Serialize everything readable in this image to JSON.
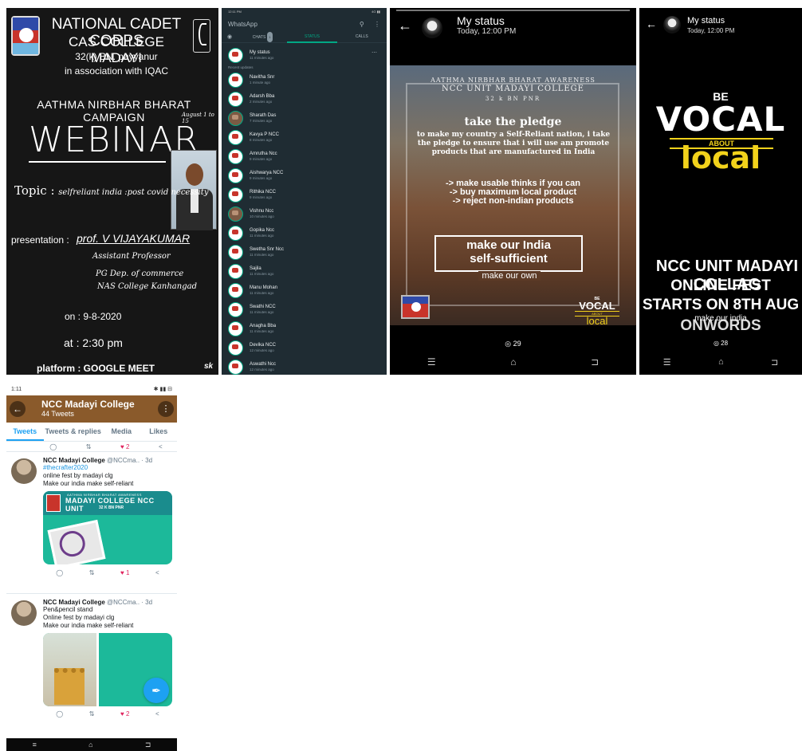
{
  "poster": {
    "line1": "NATIONAL CADET CORPS",
    "line2": "CAS COLLEGE MADAYI",
    "line3": "32(k) BN. payyanur",
    "line4": "in association with IQAC",
    "campaign": "AATHMA NIRBHAR BHARAT CAMPAIGN",
    "dates": "August 1 to 15",
    "webinar": "WEBINAR",
    "topic_label": "Topic :",
    "topic_value": "selfreliant india :post covid necessity",
    "presentation_label": "presentation :",
    "presenter": "prof. V VIJAYAKUMAR",
    "presenter_lines": [
      "Assistant Professor",
      "PG Dep. of commerce",
      "NAS College Kanhangad"
    ],
    "on": "on  : 9-8-2020",
    "at": "at  : 2:30 pm",
    "platform": "platform  : GOOGLE MEET",
    "signature": "sk"
  },
  "whatsapp": {
    "status_time": "12:11 PM",
    "status_icons": "4G ▮▮",
    "app_title": "WhatsApp",
    "tabs": [
      "CHATS",
      "STATUS",
      "CALLS"
    ],
    "chats_badge": "1",
    "my_status": {
      "name": "My status",
      "time": "11 minutes ago"
    },
    "recent_label": "Recent updates",
    "updates": [
      {
        "name": "Navitha Snr",
        "time": "1 minute ago"
      },
      {
        "name": "Adarsh Bba",
        "time": "2 minutes ago"
      },
      {
        "name": "Sharath Das",
        "time": "7 minutes ago"
      },
      {
        "name": "Kavya P NCC",
        "time": "8 minutes ago"
      },
      {
        "name": "Amrutha Ncc",
        "time": "9 minutes ago"
      },
      {
        "name": "Aishwarya NCC",
        "time": "9 minutes ago"
      },
      {
        "name": "Rithika NCC",
        "time": "9 minutes ago"
      },
      {
        "name": "Vishnu Ncc",
        "time": "10 minutes ago"
      },
      {
        "name": "Gopika Ncc",
        "time": "11 minutes ago"
      },
      {
        "name": "Swetha Snr Ncc",
        "time": "11 minutes ago"
      },
      {
        "name": "Sajila",
        "time": "11 minutes ago"
      },
      {
        "name": "Manu Mohan",
        "time": "11 minutes ago"
      },
      {
        "name": "Swathi NCC",
        "time": "11 minutes ago"
      },
      {
        "name": "Anagha Bba",
        "time": "11 minutes ago"
      },
      {
        "name": "Devika NCC",
        "time": "12 minutes ago"
      },
      {
        "name": "Aswathi Ncc",
        "time": "12 minutes ago"
      }
    ]
  },
  "pledge_status": {
    "title": "My status",
    "time": "Today, 12:00 PM",
    "aw1": "AATHMA NIRBHAR BHARAT AWARENESS",
    "aw2": "NCC UNIT MADAYI COLLEGE",
    "aw3": "32  k  BN  PNR",
    "heading": "take the pledge",
    "text": "to make my country a Self-Reliant nation, i take the pledge to ensure that i will use am promote products that are manufactured in India",
    "bullets": [
      "-> make usable thinks if you can",
      "-> buy maximum local product",
      "-> reject non-indian products"
    ],
    "box1": "make our India",
    "box2": "self-sufficient",
    "box3": "make our own",
    "vocal_be": "BE",
    "vocal_v": "VOCAL",
    "vocal_about": "ABOUT",
    "vocal_local": "local",
    "views": "29",
    "nav": [
      "☰",
      "⌂",
      "⊐"
    ]
  },
  "vocal_status": {
    "title": "My status",
    "time": "Today, 12:00 PM",
    "be": "BE",
    "vocal": "VOCAL",
    "about": "ABOUT",
    "local": "local",
    "fest1": "NCC UNIT MADAYI COLLAG",
    "fest2": "ONLINE FEST",
    "fest3": "STARTS ON 8TH AUG",
    "fest4": "ONWORDS",
    "ourindia": "make our india",
    "views": "28",
    "nav": [
      "☰",
      "⌂",
      "⊐"
    ]
  },
  "twitter": {
    "status_left": "1:11",
    "status_right": "✱ ▮▮ ⊟",
    "profile_name": "NCC Madayi College",
    "tweet_count": "44 Tweets",
    "tabs": [
      "Tweets",
      "Tweets & replies",
      "Media",
      "Likes"
    ],
    "top_actions": {
      "likes": "2"
    },
    "tweets": [
      {
        "name": "NCC Madayi College",
        "handle": "@NCCma..",
        "age": "· 3d",
        "lines": [
          "#thecrafter2020",
          "online fest by madayi clg",
          "Make our india make self-reliant"
        ],
        "media_text1": "AATHMA NIRBHAR BHARAT AWARENESS",
        "media_text2": "MADAYI COLLEGE NCC UNIT",
        "media_text3": "32 K BN PNR",
        "likes": "1"
      },
      {
        "name": "NCC Madayi College",
        "handle": "@NCCma..",
        "age": "· 3d",
        "lines": [
          "Pen&pencil stand",
          "Online fest by madayi clg",
          "Make our india make self-reliant"
        ],
        "likes": "2"
      }
    ],
    "nav": [
      "≡",
      "⌂",
      "⊐"
    ]
  }
}
